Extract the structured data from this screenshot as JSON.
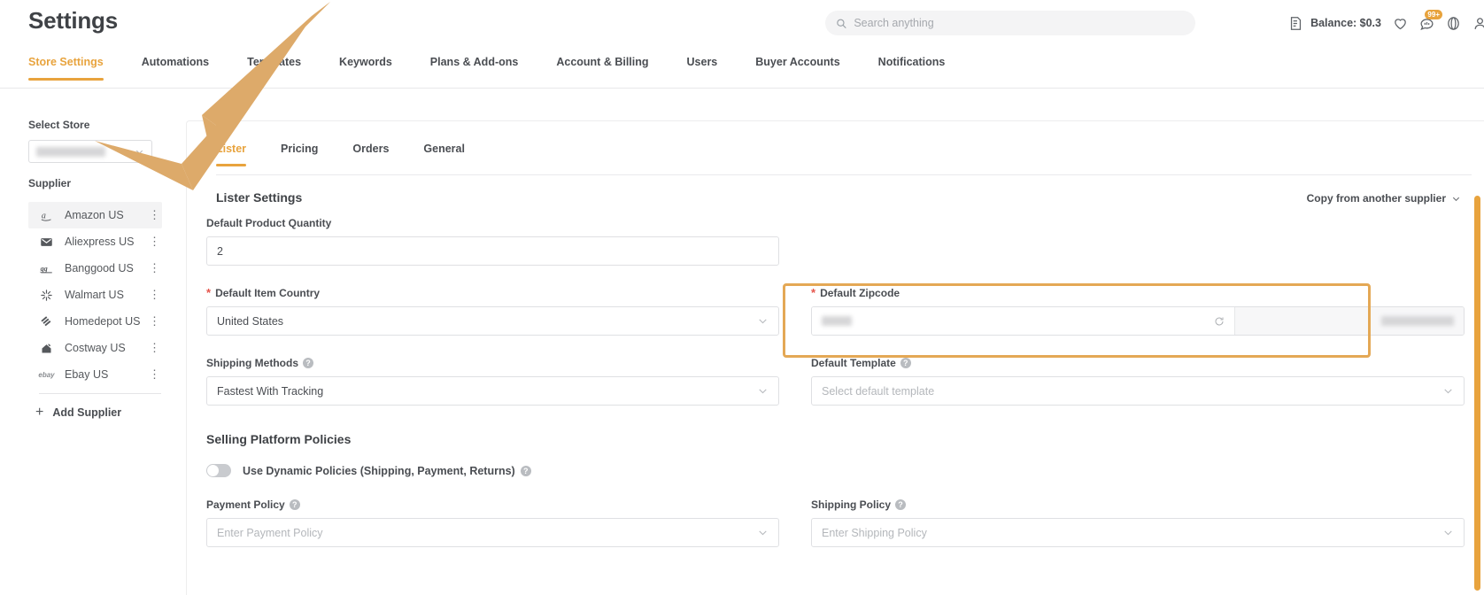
{
  "header": {
    "title": "Settings",
    "search_placeholder": "Search anything",
    "search_value": "",
    "balance": "Balance: $0.3",
    "notification_badge": "99+",
    "icons": [
      "search-icon",
      "notes-icon",
      "heart-icon",
      "chat-icon",
      "help-icon",
      "user-icon"
    ]
  },
  "main_nav": {
    "tabs": [
      {
        "label": "Store Settings",
        "active": true
      },
      {
        "label": "Automations",
        "active": false
      },
      {
        "label": "Templates",
        "active": false
      },
      {
        "label": "Keywords",
        "active": false
      },
      {
        "label": "Plans & Add-ons",
        "active": false
      },
      {
        "label": "Account & Billing",
        "active": false
      },
      {
        "label": "Users",
        "active": false
      },
      {
        "label": "Buyer Accounts",
        "active": false
      },
      {
        "label": "Notifications",
        "active": false
      }
    ]
  },
  "sidebar": {
    "select_store_label": "Select Store",
    "store_value_redacted": true,
    "supplier_label": "Supplier",
    "suppliers": [
      {
        "name": "Amazon US",
        "icon": "amazon-icon",
        "selected": true
      },
      {
        "name": "Aliexpress US",
        "icon": "aliexpress-icon",
        "selected": false
      },
      {
        "name": "Banggood US",
        "icon": "banggood-icon",
        "selected": false
      },
      {
        "name": "Walmart US",
        "icon": "walmart-icon",
        "selected": false
      },
      {
        "name": "Homedepot US",
        "icon": "homedepot-icon",
        "selected": false
      },
      {
        "name": "Costway US",
        "icon": "costway-icon",
        "selected": false
      },
      {
        "name": "Ebay US",
        "icon": "ebay-icon",
        "selected": false
      }
    ],
    "add_supplier_label": "Add Supplier"
  },
  "panel": {
    "tabs": [
      {
        "label": "Lister",
        "active": true
      },
      {
        "label": "Pricing",
        "active": false
      },
      {
        "label": "Orders",
        "active": false
      },
      {
        "label": "General",
        "active": false
      }
    ],
    "section_title": "Lister Settings",
    "copy_from_label": "Copy from another supplier",
    "fields": {
      "default_product_quantity": {
        "label": "Default Product Quantity",
        "value": "2",
        "required": false
      },
      "default_item_country": {
        "label": "Default Item Country",
        "value": "United States",
        "required": true
      },
      "default_zipcode": {
        "label": "Default Zipcode",
        "value_redacted": true,
        "secondary_value_redacted": true,
        "required": true,
        "highlighted": true,
        "refresh_icon": "refresh-icon"
      },
      "shipping_methods": {
        "label": "Shipping Methods",
        "value": "Fastest With Tracking",
        "has_help": true
      },
      "default_template": {
        "label": "Default Template",
        "placeholder": "Select default template",
        "value": "",
        "has_help": true
      },
      "payment_policy": {
        "label": "Payment Policy",
        "placeholder": "Enter Payment Policy",
        "value": "",
        "has_help": true
      },
      "shipping_policy": {
        "label": "Shipping Policy",
        "placeholder": "Enter Shipping Policy",
        "value": "",
        "has_help": true
      }
    },
    "policies": {
      "heading": "Selling Platform Policies",
      "dynamic_toggle_label": "Use Dynamic Policies (Shipping, Payment, Returns)",
      "dynamic_toggle_on": false
    }
  },
  "annotations": {
    "arrow_color": "#ddaa6a",
    "arrow_targets": [
      "store-select",
      "lister-tab"
    ]
  },
  "colors": {
    "accent": "#e8a33d",
    "highlight_border": "#e4a855",
    "text": "#4a4d52",
    "required": "#e5544b"
  }
}
